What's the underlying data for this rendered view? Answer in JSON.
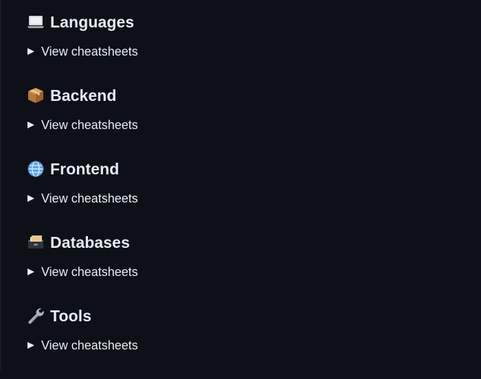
{
  "sections": [
    {
      "icon": "laptop-icon",
      "title": "Languages",
      "summary_label": "View cheatsheets"
    },
    {
      "icon": "package-icon",
      "title": "Backend",
      "summary_label": "View cheatsheets"
    },
    {
      "icon": "globe-icon",
      "title": "Frontend",
      "summary_label": "View cheatsheets"
    },
    {
      "icon": "card-file-box-icon",
      "title": "Databases",
      "summary_label": "View cheatsheets"
    },
    {
      "icon": "wrench-icon",
      "title": "Tools",
      "summary_label": "View cheatsheets"
    }
  ],
  "colors": {
    "background": "#0d1117",
    "text": "#e6edf3"
  }
}
